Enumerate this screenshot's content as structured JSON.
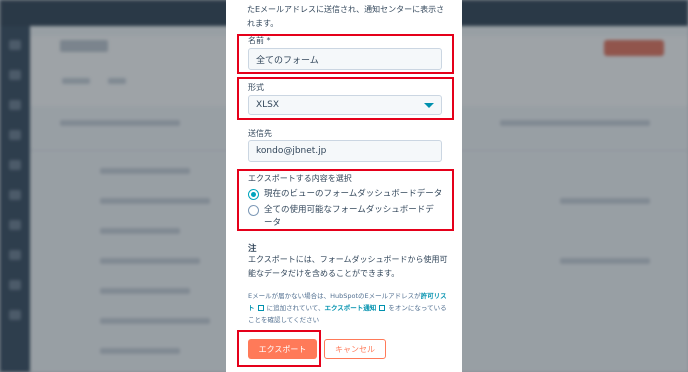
{
  "modal": {
    "intro": "たEメールアドレスに送信され、通知センターに表示されます。",
    "name_field": {
      "label": "名前",
      "required_mark": "*",
      "value": "全てのフォーム"
    },
    "format_field": {
      "label": "形式",
      "value": "XLSX"
    },
    "recipient_field": {
      "label": "送信先",
      "value": "kondo@jbnet.jp"
    },
    "export_content": {
      "label": "エクスポートする内容を選択",
      "options": [
        {
          "label": "現在のビューのフォームダッシュボードデータ",
          "selected": true
        },
        {
          "label": "全ての使用可能なフォームダッシュボードデータ",
          "selected": false
        }
      ]
    },
    "note": {
      "heading": "注",
      "text": "エクスポートには、フォームダッシュボードから使用可能なデータだけを含めることができます。"
    },
    "footnote": {
      "part1": "Eメールが届かない場合は、HubSpotのEメールアドレスが",
      "link1": "許可リスト",
      "part2": "に追加されていて、",
      "link2": "エクスポート通知",
      "part3": "をオンになっていることを確認してください"
    },
    "buttons": {
      "export": "エクスポート",
      "cancel": "キャンセル"
    }
  },
  "colors": {
    "accent": "#ff7a59",
    "radio": "#00a4bd",
    "link": "#0091ae",
    "highlight": "#e5001a"
  }
}
